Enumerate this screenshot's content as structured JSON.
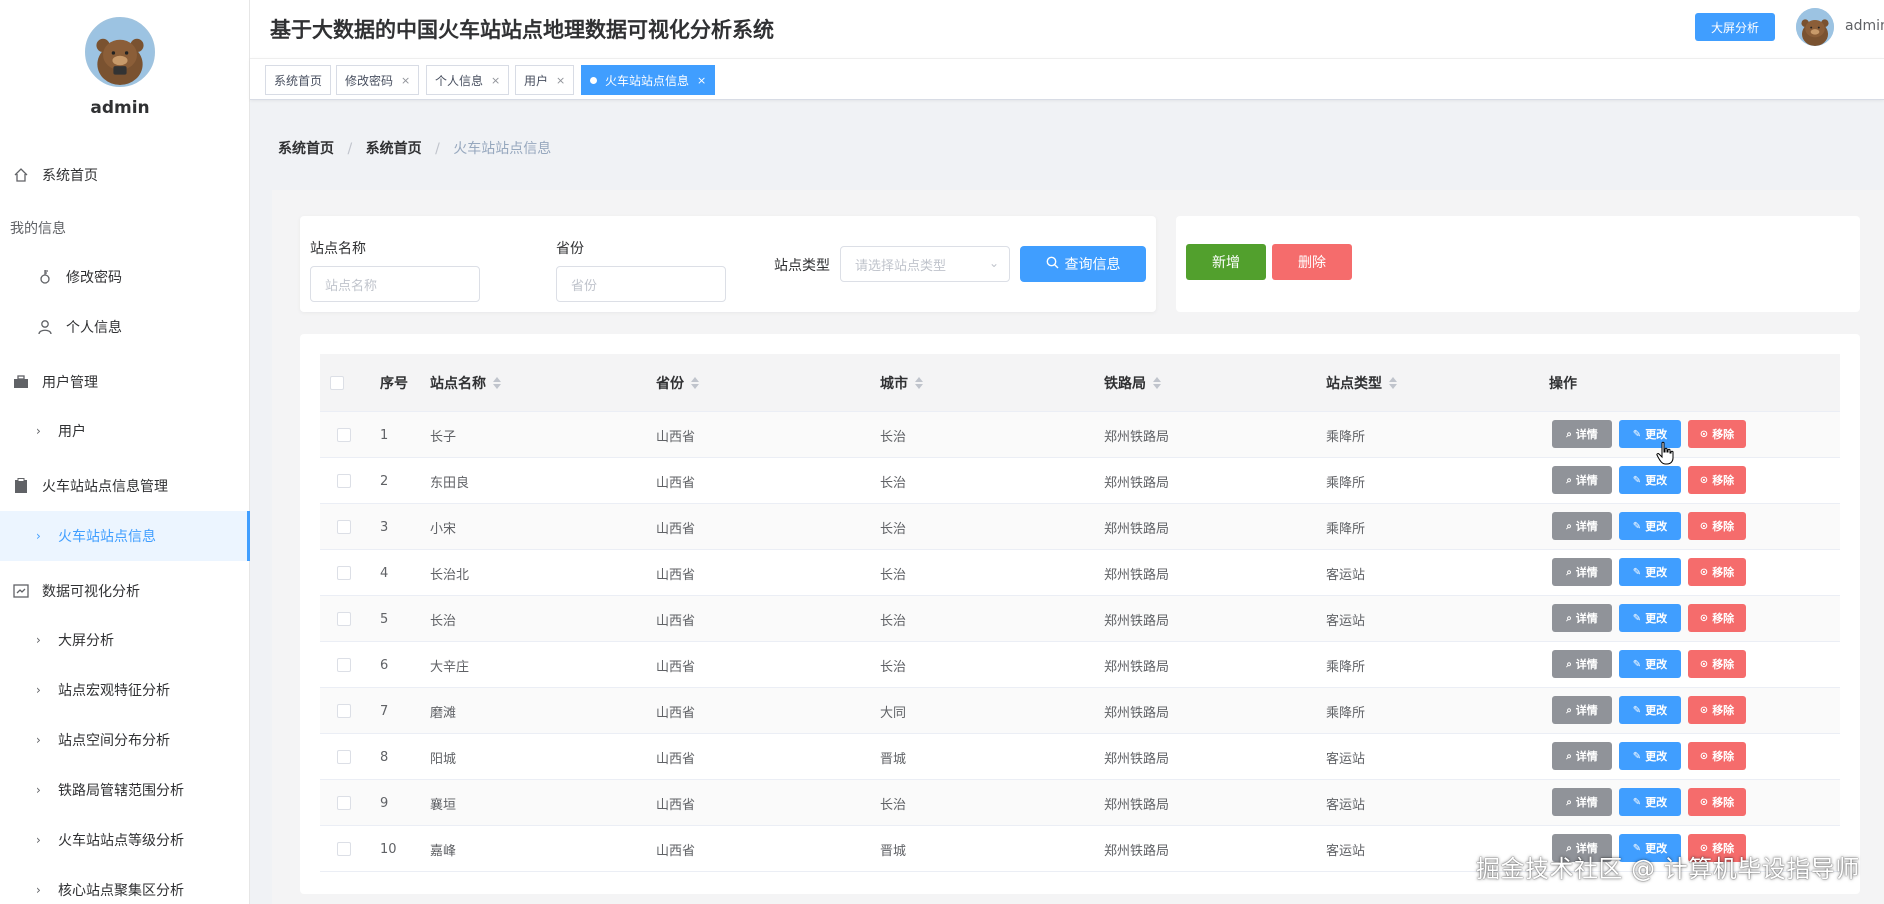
{
  "app": {
    "title": "基于大数据的中国火车站站点地理数据可视化分析系统",
    "bigscreen_label": "大屏分析",
    "username": "admin"
  },
  "sidebar": {
    "username": "admin",
    "items": [
      {
        "label": "系统首页",
        "icon": "home-icon"
      },
      {
        "label": "我的信息"
      },
      {
        "label": "修改密码",
        "icon": "lock-icon"
      },
      {
        "label": "个人信息",
        "icon": "user-icon"
      },
      {
        "label": "用户管理",
        "icon": "briefcase-icon"
      },
      {
        "label": "用户"
      },
      {
        "label": "火车站站点信息管理",
        "icon": "clipboard-icon"
      },
      {
        "label": "火车站站点信息"
      },
      {
        "label": "数据可视化分析",
        "icon": "chart-icon"
      },
      {
        "label": "大屏分析"
      },
      {
        "label": "站点宏观特征分析"
      },
      {
        "label": "站点空间分布分析"
      },
      {
        "label": "铁路局管辖范围分析"
      },
      {
        "label": "火车站站点等级分析"
      },
      {
        "label": "核心站点聚集区分析"
      }
    ]
  },
  "tabs": [
    {
      "label": "系统首页"
    },
    {
      "label": "修改密码",
      "close": "×"
    },
    {
      "label": "个人信息",
      "close": "×"
    },
    {
      "label": "用户",
      "close": "×"
    },
    {
      "label": "火车站站点信息",
      "close": "×"
    }
  ],
  "breadcrumb": [
    "系统首页",
    "系统首页",
    "火车站站点信息"
  ],
  "breadcrumb_sep": "/",
  "search": {
    "name_label": "站点名称",
    "name_placeholder": "站点名称",
    "province_label": "省份",
    "province_placeholder": "省份",
    "type_label": "站点类型",
    "type_placeholder": "请选择站点类型",
    "query_label": "查询信息"
  },
  "actions": {
    "add": "新增",
    "delete": "删除"
  },
  "table": {
    "headers": {
      "index": "序号",
      "name": "站点名称",
      "province": "省份",
      "city": "城市",
      "bureau": "铁路局",
      "type": "站点类型",
      "ops": "操作"
    },
    "op_labels": {
      "detail": "详情",
      "edit": "更改",
      "remove": "移除"
    },
    "rows": [
      {
        "index": "1",
        "name": "长子",
        "province": "山西省",
        "city": "长治",
        "bureau": "郑州铁路局",
        "type": "乘降所"
      },
      {
        "index": "2",
        "name": "东田良",
        "province": "山西省",
        "city": "长治",
        "bureau": "郑州铁路局",
        "type": "乘降所"
      },
      {
        "index": "3",
        "name": "小宋",
        "province": "山西省",
        "city": "长治",
        "bureau": "郑州铁路局",
        "type": "乘降所"
      },
      {
        "index": "4",
        "name": "长治北",
        "province": "山西省",
        "city": "长治",
        "bureau": "郑州铁路局",
        "type": "客运站"
      },
      {
        "index": "5",
        "name": "长治",
        "province": "山西省",
        "city": "长治",
        "bureau": "郑州铁路局",
        "type": "客运站"
      },
      {
        "index": "6",
        "name": "大辛庄",
        "province": "山西省",
        "city": "长治",
        "bureau": "郑州铁路局",
        "type": "乘降所"
      },
      {
        "index": "7",
        "name": "磨滩",
        "province": "山西省",
        "city": "大同",
        "bureau": "郑州铁路局",
        "type": "乘降所"
      },
      {
        "index": "8",
        "name": "阳城",
        "province": "山西省",
        "city": "晋城",
        "bureau": "郑州铁路局",
        "type": "客运站"
      },
      {
        "index": "9",
        "name": "襄垣",
        "province": "山西省",
        "city": "长治",
        "bureau": "郑州铁路局",
        "type": "客运站"
      },
      {
        "index": "10",
        "name": "嘉峰",
        "province": "山西省",
        "city": "晋城",
        "bureau": "郑州铁路局",
        "type": "客运站"
      }
    ]
  },
  "watermark": "掘金技术社区 @ 计算机毕设指导师",
  "colors": {
    "primary": "#409eff",
    "success": "#52a02d",
    "danger": "#f56c6c",
    "info": "#909399"
  }
}
